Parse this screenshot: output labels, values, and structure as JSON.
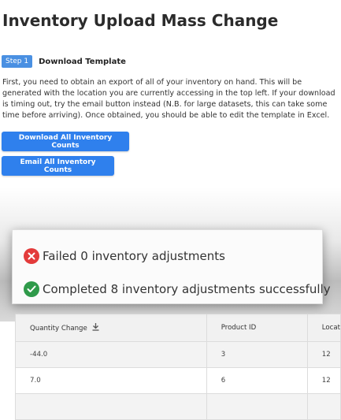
{
  "title": "Inventory Upload Mass Change",
  "step": {
    "badge": "Step 1",
    "label": "Download Template"
  },
  "description": "First, you need to obtain an export of all of your inventory on hand. This will be generated with the location you are currently accessing in the top left. If your download is timing out, try the email button instead (N.B. for large datasets, this can take some time before arriving). Once obtained, you should be able to edit the template in Excel.",
  "buttons": {
    "download": "Download All Inventory Counts",
    "email": "Email All Inventory Counts"
  },
  "toast": {
    "failed": "Failed 0 inventory adjustments",
    "completed": "Completed 8 inventory adjustments successfully"
  },
  "table": {
    "headers": [
      "Quantity Change",
      "Product ID",
      "Locat"
    ],
    "rows": [
      [
        "-44.0",
        "3",
        "12"
      ],
      [
        "7.0",
        "6",
        "12"
      ],
      [
        "",
        "",
        ""
      ]
    ]
  },
  "colors": {
    "primary": "#2f80ed",
    "fail": "#e33b3b",
    "success": "#2f9a4a"
  }
}
